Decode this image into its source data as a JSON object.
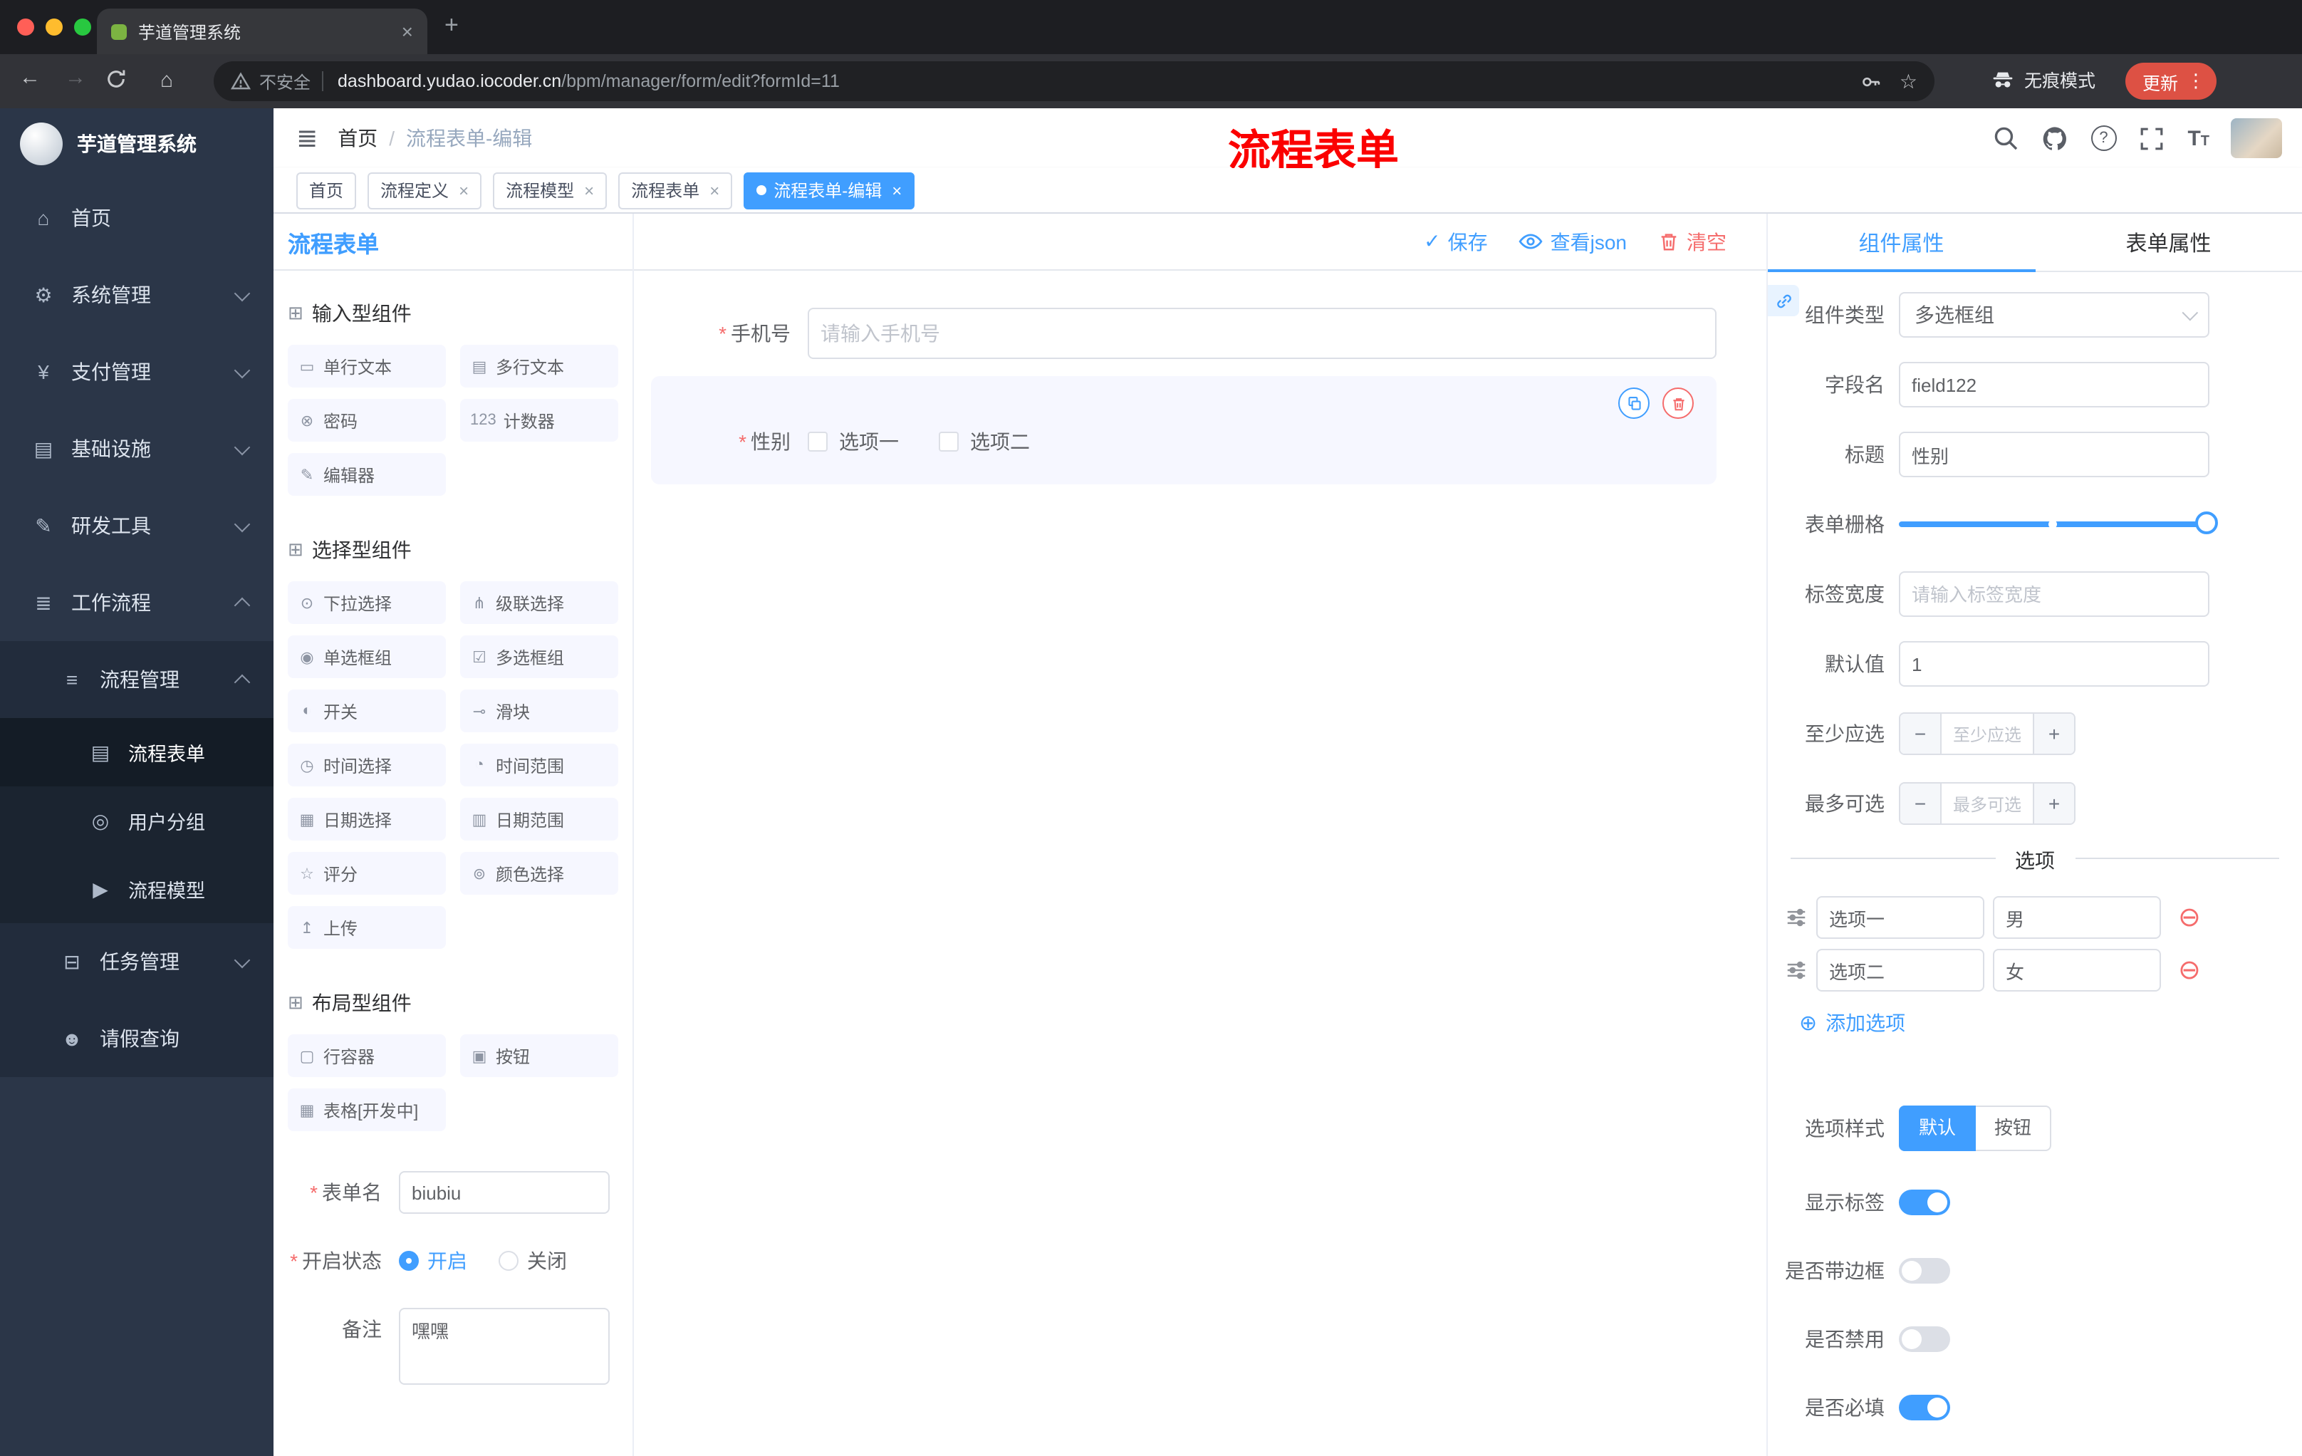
{
  "browser": {
    "tab_title": "芋道管理系统",
    "security_label": "不安全",
    "url_domain": "dashboard.yudao.iocoder.cn",
    "url_path": "/bpm/manager/form/edit?formId=11",
    "incognito_label": "无痕模式",
    "update_label": "更新",
    "update_color": "#dd5144"
  },
  "sidebar": {
    "logo_title": "芋道管理系统",
    "items": [
      {
        "label": "首页",
        "icon": "home-icon",
        "glyph": "⌂"
      },
      {
        "label": "系统管理",
        "icon": "gear-icon",
        "glyph": "⚙"
      },
      {
        "label": "支付管理",
        "icon": "yen-icon",
        "glyph": "¥"
      },
      {
        "label": "基础设施",
        "icon": "infra-icon",
        "glyph": "▤"
      },
      {
        "label": "研发工具",
        "icon": "tools-icon",
        "glyph": "✎"
      },
      {
        "label": "工作流程",
        "icon": "workflow-icon",
        "glyph": "≣"
      },
      {
        "label": "流程管理",
        "icon": "process-manage-icon",
        "glyph": "≡"
      },
      {
        "label": "流程表单",
        "icon": "form-icon",
        "glyph": "▤"
      },
      {
        "label": "用户分组",
        "icon": "user-group-icon",
        "glyph": "◎"
      },
      {
        "label": "流程模型",
        "icon": "model-icon",
        "glyph": "▶"
      },
      {
        "label": "任务管理",
        "icon": "task-icon",
        "glyph": "⊟"
      },
      {
        "label": "请假查询",
        "icon": "person-icon",
        "glyph": "☻"
      }
    ]
  },
  "header": {
    "breadcrumb_home": "首页",
    "breadcrumb_current": "流程表单-编辑",
    "annotation": "流程表单",
    "annotation_color": "#fb0000"
  },
  "tags": [
    {
      "label": "首页"
    },
    {
      "label": "流程定义"
    },
    {
      "label": "流程模型"
    },
    {
      "label": "流程表单"
    },
    {
      "label": "流程表单-编辑"
    }
  ],
  "designer": {
    "title": "流程表单",
    "save": "保存",
    "view_json": "查看json",
    "clear": "清空"
  },
  "palette": {
    "groups": [
      {
        "title": "输入型组件",
        "items": [
          {
            "glyph": "▭",
            "label": "单行文本"
          },
          {
            "glyph": "▤",
            "label": "多行文本"
          },
          {
            "glyph": "⊗",
            "label": "密码"
          },
          {
            "glyph": "123",
            "label": "计数器"
          },
          {
            "glyph": "✎",
            "label": "编辑器"
          }
        ]
      },
      {
        "title": "选择型组件",
        "items": [
          {
            "glyph": "⊙",
            "label": "下拉选择"
          },
          {
            "glyph": "⋔",
            "label": "级联选择"
          },
          {
            "glyph": "◉",
            "label": "单选框组"
          },
          {
            "glyph": "☑",
            "label": "多选框组"
          },
          {
            "glyph": "◐",
            "label": "开关"
          },
          {
            "glyph": "⊸",
            "label": "滑块"
          },
          {
            "glyph": "◷",
            "label": "时间选择"
          },
          {
            "glyph": "◔",
            "label": "时间范围"
          },
          {
            "glyph": "▦",
            "label": "日期选择"
          },
          {
            "glyph": "▥",
            "label": "日期范围"
          },
          {
            "glyph": "☆",
            "label": "评分"
          },
          {
            "glyph": "⊚",
            "label": "颜色选择"
          },
          {
            "glyph": "↥",
            "label": "上传"
          }
        ]
      },
      {
        "title": "布局型组件",
        "items": [
          {
            "glyph": "▢",
            "label": "行容器"
          },
          {
            "glyph": "▣",
            "label": "按钮"
          },
          {
            "glyph": "▦",
            "label": "表格[开发中]"
          }
        ]
      }
    ],
    "form": {
      "name_label": "表单名",
      "name_value": "biubiu",
      "status_label": "开启状态",
      "status_on": "开启",
      "status_off": "关闭",
      "remark_label": "备注",
      "remark_value": "嘿嘿"
    }
  },
  "canvas": {
    "phone_label": "手机号",
    "phone_placeholder": "请输入手机号",
    "gender_label": "性别",
    "gender_options": [
      "选项一",
      "选项二"
    ]
  },
  "props": {
    "tab_component": "组件属性",
    "tab_form": "表单属性",
    "component_type_label": "组件类型",
    "component_type_value": "多选框组",
    "field_label": "字段名",
    "field_value": "field122",
    "title_label": "标题",
    "title_value": "性别",
    "grid_label": "表单栅格",
    "tag_width_label": "标签宽度",
    "tag_width_placeholder": "请输入标签宽度",
    "default_label": "默认值",
    "default_value": "1",
    "min_label": "至少应选",
    "min_placeholder": "至少应选",
    "max_label": "最多可选",
    "max_placeholder": "最多可选",
    "options_title": "选项",
    "options": [
      {
        "label": "选项一",
        "value": "男"
      },
      {
        "label": "选项二",
        "value": "女"
      }
    ],
    "add_option": "添加选项",
    "style_label": "选项样式",
    "style_default": "默认",
    "style_button": "按钮",
    "toggle_show_label": "显示标签",
    "toggle_border": "是否带边框",
    "toggle_disabled": "是否禁用",
    "toggle_required": "是否必填",
    "accent_color": "#409eff",
    "danger_color": "#f56c6c"
  }
}
